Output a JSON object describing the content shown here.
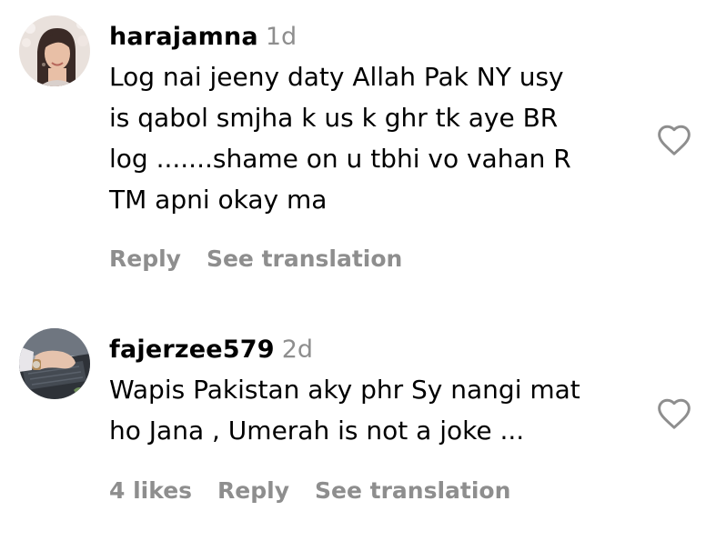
{
  "comments": [
    {
      "username": "harajamna",
      "time": "1d",
      "lines": [
        "Log nai jeeny daty Allah Pak NY usy",
        "is qabol smjha k us k ghr tk aye BR",
        "log .......shame on u tbhi vo vahan R",
        "TM apni okay ma"
      ],
      "likes": "",
      "reply": "Reply",
      "see_translation": "See translation",
      "avatar_icon": "profile-photo-woman",
      "like_icon": "heart-outline-icon"
    },
    {
      "username": "fajerzee579",
      "time": "2d",
      "lines": [
        "Wapis Pakistan aky phr Sy nangi mat",
        "ho Jana , Umerah is not a joke ..."
      ],
      "likes": "4 likes",
      "reply": "Reply",
      "see_translation": "See translation",
      "avatar_icon": "profile-photo-hand-laptop",
      "like_icon": "heart-outline-icon"
    }
  ],
  "colors": {
    "text": "#000000",
    "muted": "#8e8e8e",
    "background": "#ffffff"
  }
}
